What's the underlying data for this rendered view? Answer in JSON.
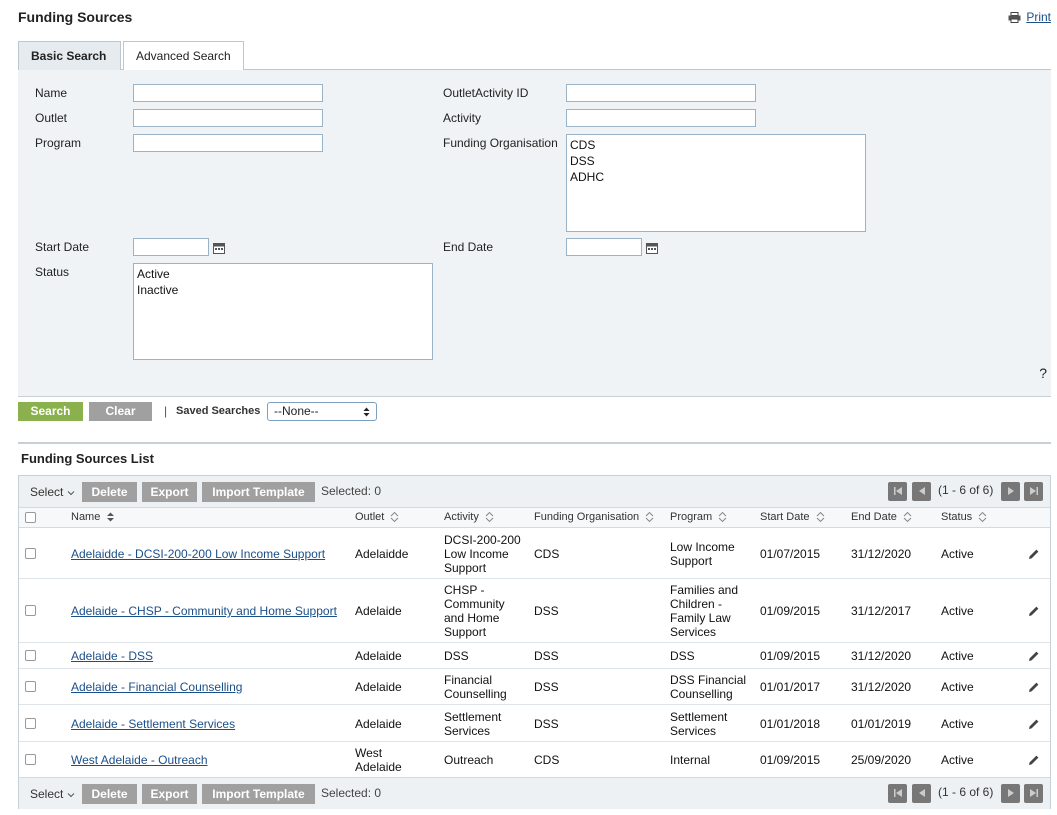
{
  "page": {
    "title": "Funding Sources",
    "print_label": "Print"
  },
  "tabs": [
    {
      "label": "Basic Search",
      "active": true
    },
    {
      "label": "Advanced Search",
      "active": false
    }
  ],
  "search": {
    "name_label": "Name",
    "outlet_label": "Outlet",
    "program_label": "Program",
    "outlet_activity_id_label": "OutletActivity ID",
    "activity_label": "Activity",
    "funding_org_label": "Funding Organisation",
    "funding_org_options": [
      "CDS",
      "DSS",
      "ADHC"
    ],
    "start_date_label": "Start Date",
    "end_date_label": "End Date",
    "status_label": "Status",
    "status_options": [
      "Active",
      "Inactive"
    ],
    "help": "?",
    "search_button": "Search",
    "clear_button": "Clear",
    "separator": "|",
    "saved_searches_label": "Saved Searches",
    "saved_searches_value": "--None--"
  },
  "list": {
    "title": "Funding Sources List",
    "toolbar": {
      "select_label": "Select",
      "delete_label": "Delete",
      "export_label": "Export",
      "import_label": "Import Template",
      "selected_text": "Selected: 0",
      "pager_text": "(1 - 6 of 6)"
    },
    "columns": [
      "Name",
      "Outlet",
      "Activity",
      "Funding Organisation",
      "Program",
      "Start Date",
      "End Date",
      "Status"
    ],
    "rows": [
      {
        "name": "Adelaidde - DCSI-200-200 Low Income Support",
        "outlet": [
          "Adelaidde"
        ],
        "activity": [
          "DCSI-200-200",
          "Low Income",
          "Support"
        ],
        "funding_org": "CDS",
        "program": [
          "Low Income",
          "Support"
        ],
        "start": "01/07/2015",
        "end": "31/12/2020",
        "status": "Active"
      },
      {
        "name": "Adelaide - CHSP - Community and Home Support",
        "outlet": [
          "Adelaide"
        ],
        "activity": [
          "CHSP -",
          "Community",
          "and Home",
          "Support"
        ],
        "funding_org": "DSS",
        "program": [
          "Families and",
          "Children -",
          "Family Law",
          "Services"
        ],
        "start": "01/09/2015",
        "end": "31/12/2017",
        "status": "Active"
      },
      {
        "name": "Adelaide - DSS",
        "outlet": [
          "Adelaide"
        ],
        "activity": [
          "DSS"
        ],
        "funding_org": "DSS",
        "program": [
          "DSS"
        ],
        "start": "01/09/2015",
        "end": "31/12/2020",
        "status": "Active"
      },
      {
        "name": "Adelaide - Financial Counselling",
        "outlet": [
          "Adelaide"
        ],
        "activity": [
          "Financial",
          "Counselling"
        ],
        "funding_org": "DSS",
        "program": [
          "DSS Financial",
          "Counselling"
        ],
        "start": "01/01/2017",
        "end": "31/12/2020",
        "status": "Active"
      },
      {
        "name": "Adelaide - Settlement Services",
        "outlet": [
          "Adelaide"
        ],
        "activity": [
          "Settlement",
          "Services"
        ],
        "funding_org": "DSS",
        "program": [
          "Settlement",
          "Services"
        ],
        "start": "01/01/2018",
        "end": "01/01/2019",
        "status": "Active"
      },
      {
        "name": "West Adelaide - Outreach",
        "outlet": [
          "West",
          "Adelaide"
        ],
        "activity": [
          "Outreach"
        ],
        "funding_org": "CDS",
        "program": [
          "Internal"
        ],
        "start": "01/09/2015",
        "end": "25/09/2020",
        "status": "Active"
      }
    ]
  }
}
